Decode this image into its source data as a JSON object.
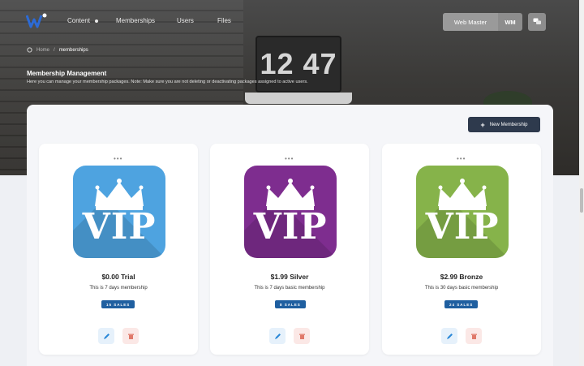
{
  "colors": {
    "accent": "#2e3a4d",
    "badge": "#1f5fa0",
    "trial": "#4ea3e0",
    "silver": "#7e2d8f",
    "bronze": "#86b34a"
  },
  "hero": {
    "clock_text": "12 47"
  },
  "nav": {
    "items": [
      {
        "label": "Content",
        "icon": "dot-icon"
      },
      {
        "label": "Memberships"
      },
      {
        "label": "Users"
      },
      {
        "label": "Files"
      }
    ],
    "user_name": "Web Master",
    "user_initials": "WM",
    "chat_icon": "chat-icon"
  },
  "breadcrumb": {
    "home": "Home",
    "separator": "/",
    "current": "memberships"
  },
  "page": {
    "title": "Membership Management",
    "subtitle": "Here you can manage your membership packages. Note: Make sure you are not deleting or deactivating packages assigned to active users."
  },
  "toolbar": {
    "new_button": "New Membership",
    "new_icon": "plus-icon"
  },
  "cards": [
    {
      "name": "$0.00 Trial",
      "desc": "This is 7 days membership",
      "sales": "15 SALES",
      "badge_text": "VIP",
      "color": "#4ea3e0"
    },
    {
      "name": "$1.99 Silver",
      "desc": "This is 7 days basic membership",
      "sales": "8 SALES",
      "badge_text": "VIP",
      "color": "#7e2d8f"
    },
    {
      "name": "$2.99 Bronze",
      "desc": "This is 30 days basic membership",
      "sales": "24 SALES",
      "badge_text": "VIP",
      "color": "#86b34a"
    }
  ],
  "card_menu": "•••"
}
